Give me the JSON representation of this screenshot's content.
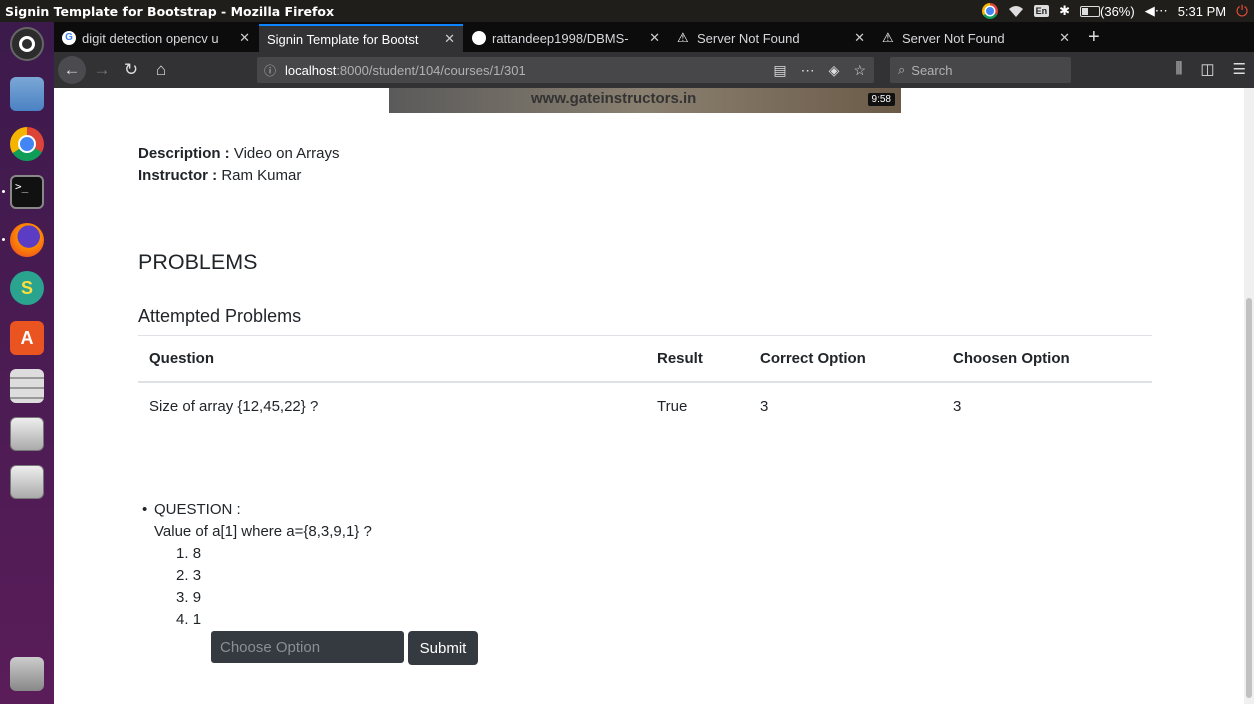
{
  "window": {
    "title": "Signin Template for Bootstrap - Mozilla Firefox"
  },
  "tray": {
    "keyboard": "En",
    "battery": "(36%)",
    "clock": "5:31 PM"
  },
  "tabs": [
    {
      "label": "digit detection opencv u",
      "icon": "google-icon",
      "active": false
    },
    {
      "label": "Signin Template for Bootst",
      "icon": "none",
      "active": true
    },
    {
      "label": "rattandeep1998/DBMS-",
      "icon": "github-icon",
      "active": false
    },
    {
      "label": "Server Not Found",
      "icon": "warning-icon",
      "active": false
    },
    {
      "label": "Server Not Found",
      "icon": "warning-icon",
      "active": false
    }
  ],
  "nav": {
    "url_host": "localhost",
    "url_path": ":8000/student/104/courses/1/301",
    "search_placeholder": "Search"
  },
  "video": {
    "watermark": "www.gateinstructors.in",
    "duration": "9:58"
  },
  "course": {
    "description_label": "Description :",
    "description": "Video on Arrays",
    "instructor_label": "Instructor :",
    "instructor": "Ram Kumar"
  },
  "problems": {
    "heading": "PROBLEMS",
    "attempted_heading": "Attempted Problems",
    "columns": [
      "Question",
      "Result",
      "Correct Option",
      "Choosen Option"
    ],
    "rows": [
      [
        "Size of array {12,45,22} ?",
        "True",
        "3",
        "3"
      ]
    ]
  },
  "question": {
    "label": "QUESTION :",
    "text": "Value of a[1] where a={8,3,9,1} ?",
    "options": [
      "8",
      "3",
      "9",
      "1"
    ],
    "input_placeholder": "Choose Option",
    "submit_label": "Submit"
  }
}
